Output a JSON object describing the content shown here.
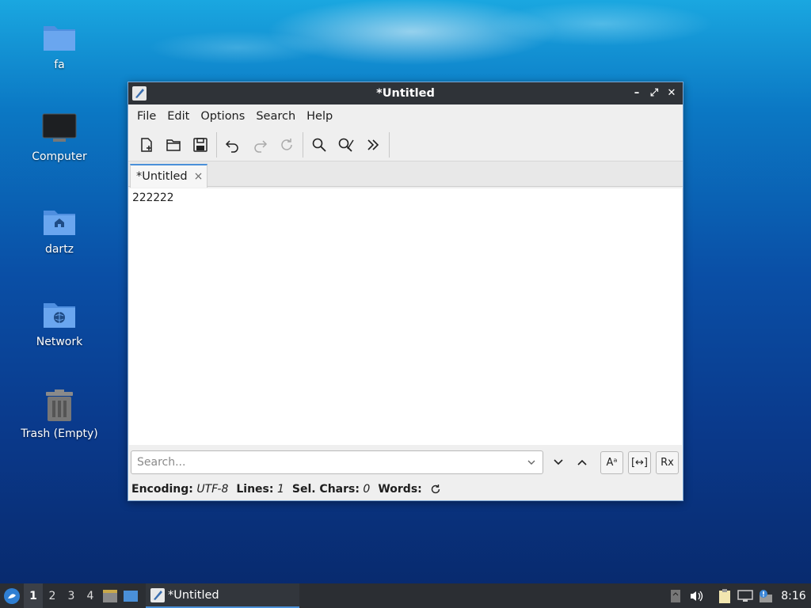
{
  "desktop": {
    "icons": [
      {
        "label": "fa"
      },
      {
        "label": "Computer"
      },
      {
        "label": "dartz"
      },
      {
        "label": "Network"
      },
      {
        "label": "Trash (Empty)"
      }
    ]
  },
  "window": {
    "title": "*Untitled",
    "controls": {
      "minimize": "–",
      "maximize": "⤢",
      "close": "✕"
    }
  },
  "menubar": {
    "items": [
      "File",
      "Edit",
      "Options",
      "Search",
      "Help"
    ]
  },
  "toolbar": {
    "buttons": [
      "new-document-icon",
      "open-folder-icon",
      "save-icon",
      "undo-icon",
      "redo-icon",
      "reload-icon",
      "find-icon",
      "find-replace-icon",
      "more-icon"
    ]
  },
  "tabs": [
    {
      "label": "*Untitled",
      "close": "×"
    }
  ],
  "editor": {
    "content": "222222"
  },
  "search": {
    "placeholder": "Search...",
    "match_case_label": "Aᵃ",
    "whole_word_label": "[↔]",
    "regex_label": "Rx"
  },
  "status": {
    "encoding_label": "Encoding:",
    "encoding_value": "UTF-8",
    "lines_label": "Lines:",
    "lines_value": "1",
    "sel_label": "Sel. Chars:",
    "sel_value": "0",
    "words_label": "Words:"
  },
  "taskbar": {
    "workspaces": [
      "1",
      "2",
      "3",
      "4"
    ],
    "active_workspace": "1",
    "task_title": "*Untitled",
    "clock": "8:16"
  },
  "colors": {
    "accent": "#4a90d9",
    "titlebar": "#2f3338",
    "taskbar": "#2b2e33",
    "folder": "#5b9be6"
  }
}
